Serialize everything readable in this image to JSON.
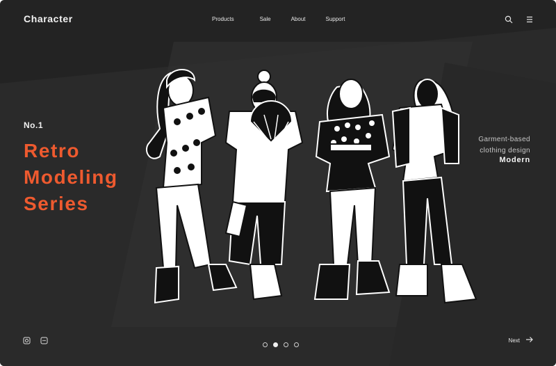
{
  "header": {
    "brand": "Character",
    "nav": [
      "Products",
      "Sale",
      "About",
      "Support"
    ],
    "icons": [
      "search-icon",
      "menu-icon"
    ]
  },
  "hero": {
    "badge": "No.1",
    "title_lines": [
      "Retro",
      "Modeling",
      "Series"
    ],
    "side_lines": [
      "Garment-based",
      "clothing design"
    ],
    "side_strong": "Modern"
  },
  "footer": {
    "social_icons": [
      "instagram-icon",
      "chat-icon"
    ],
    "pagination": {
      "count": 4,
      "active_index": 1
    },
    "next_label": "Next"
  },
  "colors": {
    "background": "#232323",
    "accent": "#ee5a2f",
    "text": "#f0f0f0"
  }
}
